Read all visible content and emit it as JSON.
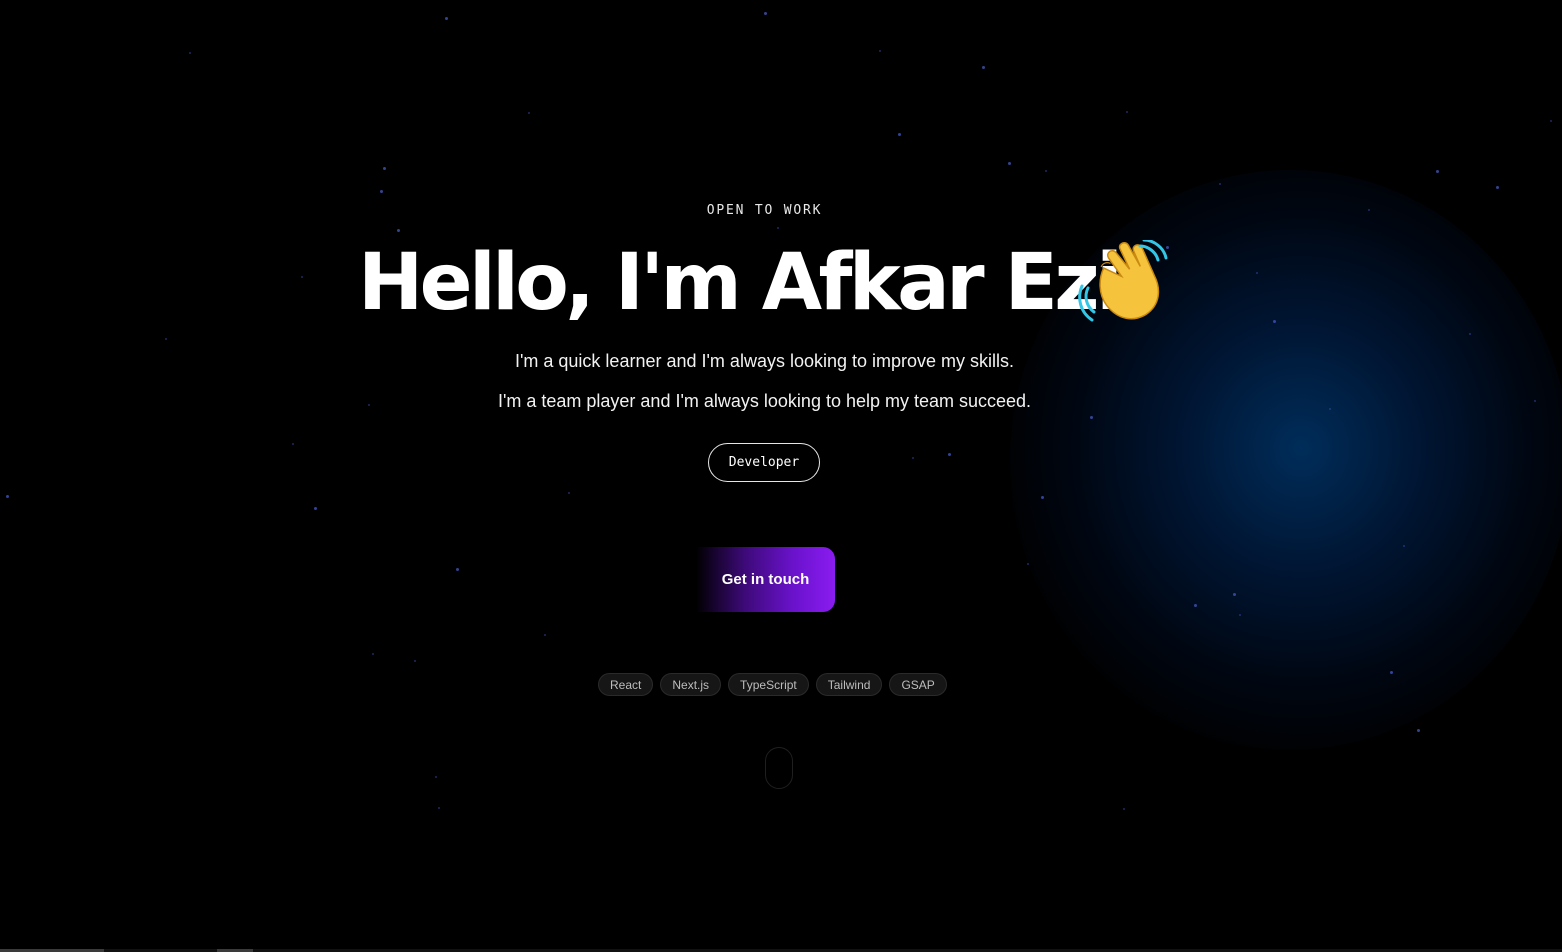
{
  "hero": {
    "badge": "OPEN TO WORK",
    "headline": "Hello, I'm Afkar Ezi",
    "wave_icon": "waving-hand-emoji",
    "tagline_1": "I'm a quick learner and I'm always looking to improve my skills.",
    "tagline_2": "I'm a team player and I'm always looking to help my team succeed.",
    "role": "Developer",
    "cta_label": "Get in touch"
  },
  "tech_tags": [
    "React",
    "Next.js",
    "TypeScript",
    "Tailwind",
    "GSAP"
  ],
  "scroll_indicator_icon": "mouse-scroll-icon",
  "colors": {
    "background": "#000000",
    "glow": "#003c78",
    "star": "#3b4fb0",
    "cta_gradient_end": "#8a1cf0",
    "wave_hand": "#f6c33d",
    "wave_lines": "#34c6e6"
  }
}
